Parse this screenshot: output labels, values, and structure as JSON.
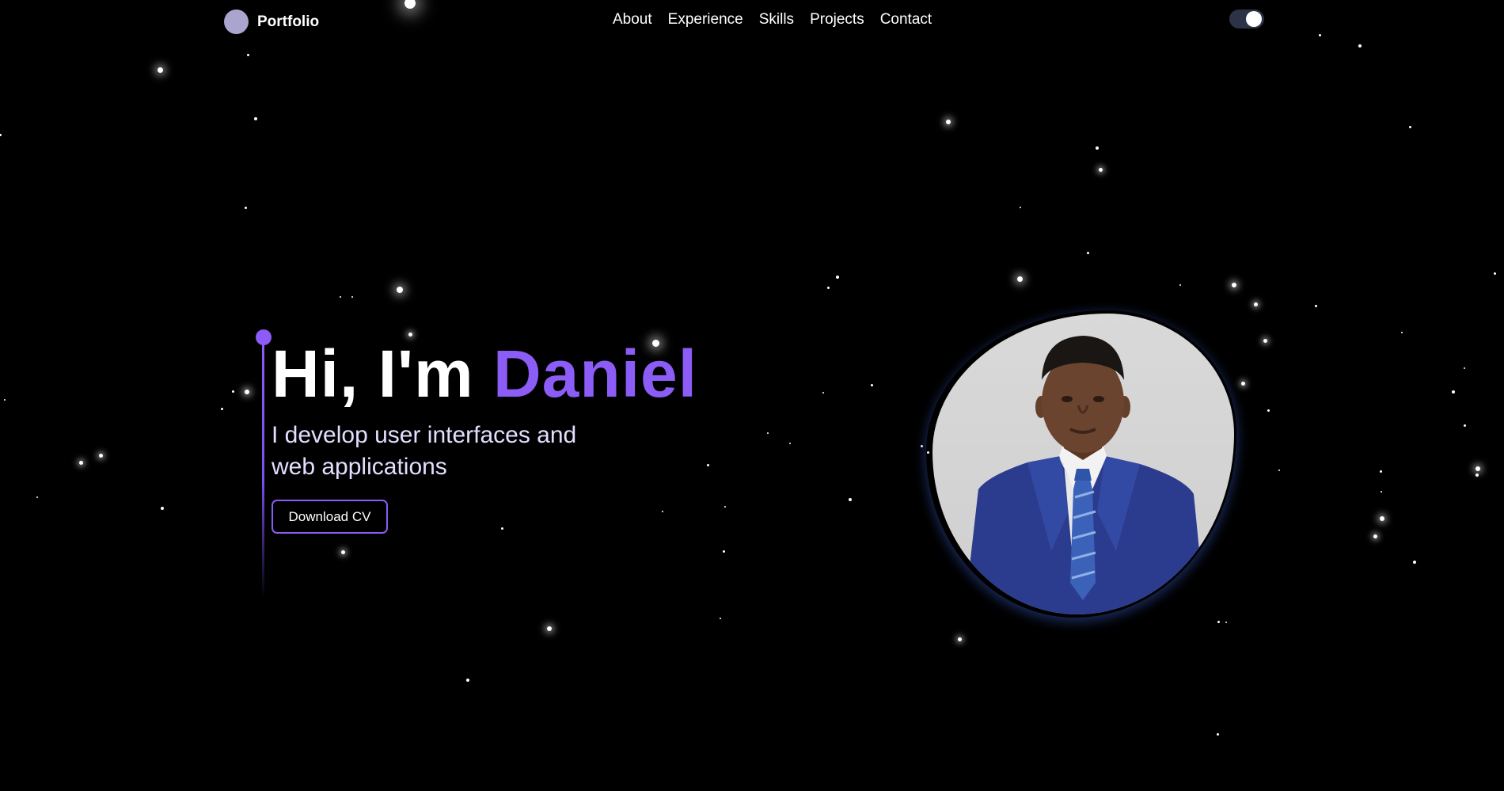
{
  "navbar": {
    "brand": {
      "name": "Portfolio"
    },
    "links": [
      {
        "label": "About"
      },
      {
        "label": "Experience"
      },
      {
        "label": "Skills"
      },
      {
        "label": "Projects"
      },
      {
        "label": "Contact"
      }
    ],
    "theme_toggle": {
      "state": "on"
    }
  },
  "hero": {
    "greeting": "Hi, I'm ",
    "name": "Daniel",
    "subtitle": "I develop user interfaces and web applications",
    "cta_label": "Download CV"
  },
  "colors": {
    "accent": "#8b5cf6",
    "background": "#000000",
    "subtitle_text": "#e3deff",
    "brand_logo": "#aaa5cf",
    "toggle_track": "#2d3347"
  }
}
